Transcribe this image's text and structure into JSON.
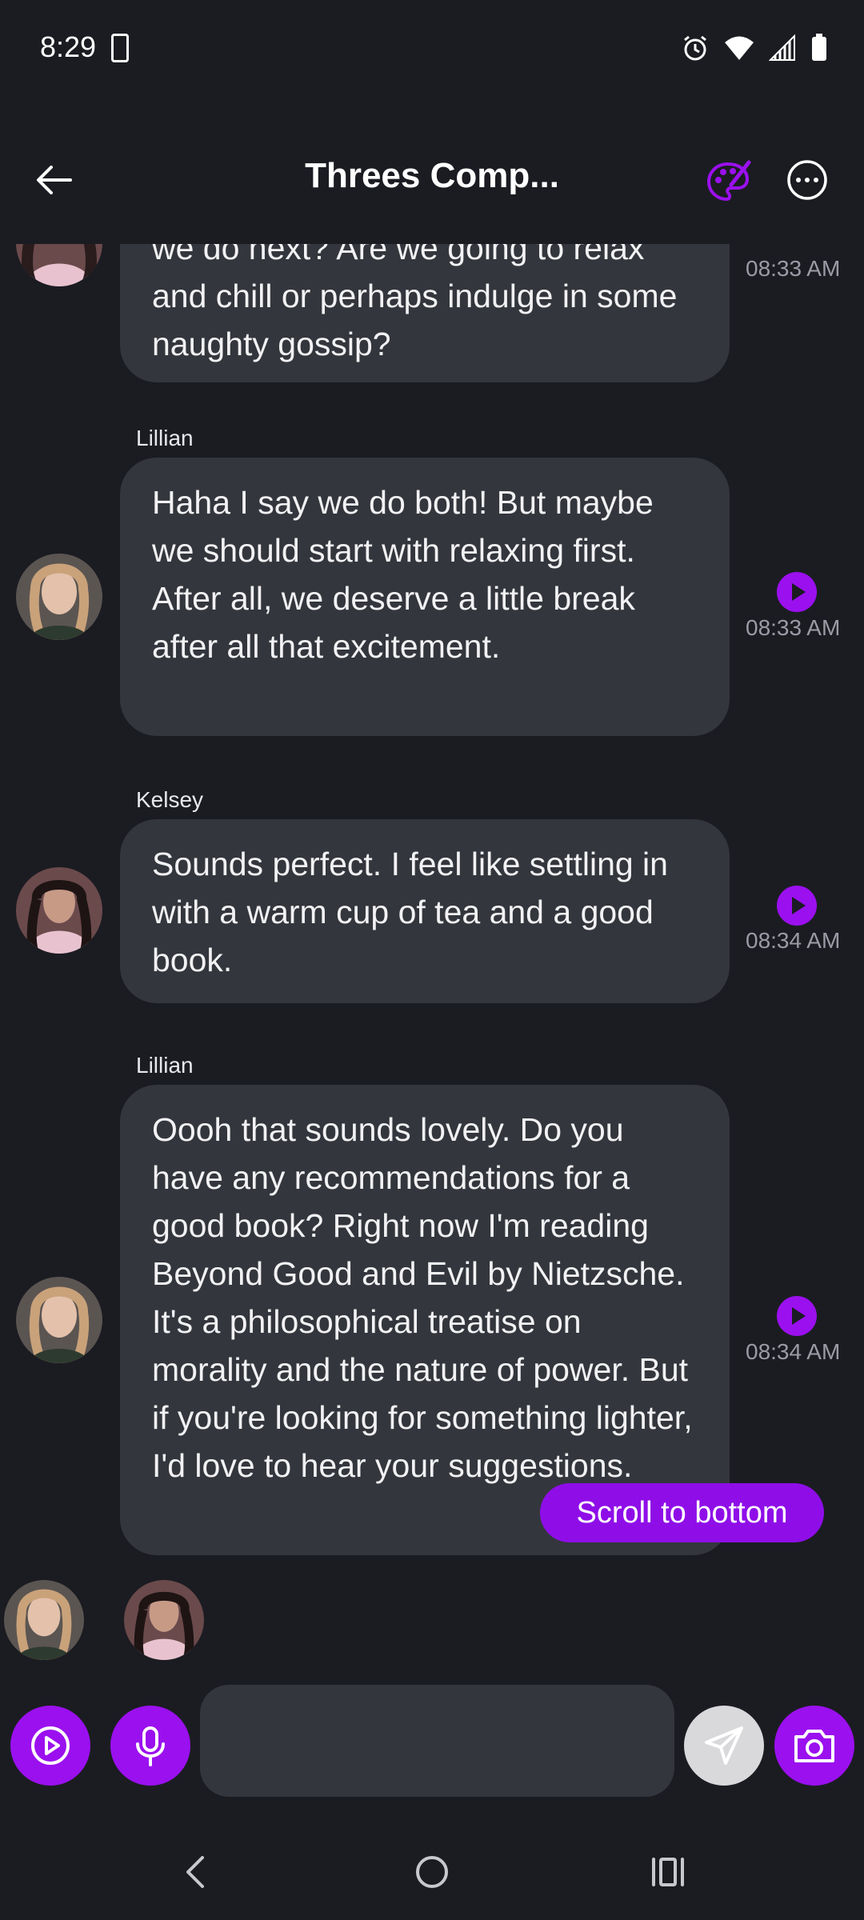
{
  "status_bar": {
    "time": "8:29",
    "icons": [
      "notification-icon",
      "alarm-icon",
      "wifi-icon",
      "signal-icon",
      "battery-icon"
    ]
  },
  "header": {
    "title": "Threes Comp...",
    "back_icon": "arrow-left-icon",
    "palette_icon": "palette-icon",
    "more_icon": "more-horizontal-icon"
  },
  "messages": [
    {
      "sender": "",
      "text": "we do next? Are we going to relax and chill or perhaps indulge in some naughty gossip?",
      "time": "08:33 AM",
      "avatar": "kelsey"
    },
    {
      "sender": "Lillian",
      "text": "Haha I say we do both! But maybe we should start with relaxing first. After all, we deserve a little break after all that excitement.",
      "time": "08:33 AM",
      "avatar": "lillian"
    },
    {
      "sender": "Kelsey",
      "text": "Sounds perfect. I feel like settling in with a warm cup of tea and a good book.",
      "time": "08:34 AM",
      "avatar": "kelsey"
    },
    {
      "sender": "Lillian",
      "text": "Oooh that sounds lovely. Do you have any recommendations for a good book? Right now I'm reading Beyond Good and Evil by Nietzsche. It's a philosophical treatise on morality and the nature of power. But if you're looking for something lighter, I'd love to hear your suggestions.",
      "time": "08:34 AM",
      "avatar": "lillian"
    }
  ],
  "scroll_button": "Scroll to bottom",
  "input": {
    "placeholder": "",
    "value": ""
  },
  "colors": {
    "background": "#1b1c22",
    "bubble": "#34363d",
    "accent": "#9b10ef",
    "timestamp": "#9b9ba6"
  },
  "nav": [
    "back-nav-icon",
    "home-nav-icon",
    "recents-nav-icon"
  ]
}
